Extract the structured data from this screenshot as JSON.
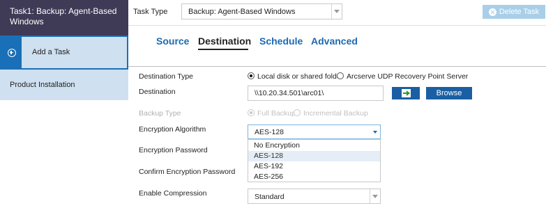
{
  "sidebar": {
    "task_title": "Task1: Backup: Agent-Based Windows",
    "add_task_label": "Add a Task",
    "product_installation_label": "Product Installation"
  },
  "topbar": {
    "task_type_label": "Task Type",
    "task_type_value": "Backup: Agent-Based Windows",
    "delete_task_label": "Delete Task"
  },
  "tabs": [
    {
      "label": "Source",
      "active": false
    },
    {
      "label": "Destination",
      "active": true
    },
    {
      "label": "Schedule",
      "active": false
    },
    {
      "label": "Advanced",
      "active": false
    }
  ],
  "form": {
    "destination_type": {
      "label": "Destination Type",
      "options": [
        {
          "label": "Local disk or shared folder",
          "checked": true
        },
        {
          "label": "Arcserve UDP Recovery Point Server",
          "checked": false
        }
      ]
    },
    "destination": {
      "label": "Destination",
      "value": "\\\\10.20.34.501\\arc01\\",
      "browse_label": "Browse"
    },
    "backup_type": {
      "label": "Backup Type",
      "disabled": true,
      "options": [
        {
          "label": "Full Backup",
          "checked": true
        },
        {
          "label": "Incremental Backup",
          "checked": false
        }
      ]
    },
    "encryption_algorithm": {
      "label": "Encryption Algorithm",
      "value": "AES-128",
      "options": [
        "No Encryption",
        "AES-128",
        "AES-192",
        "AES-256"
      ],
      "highlighted": "AES-128"
    },
    "encryption_password": {
      "label": "Encryption Password"
    },
    "confirm_encryption_password": {
      "label": "Confirm Encryption Password"
    },
    "compression": {
      "label": "Enable Compression",
      "value": "Standard"
    }
  },
  "colors": {
    "sidebar_dark": "#3f3a56",
    "sidebar_light": "#cfe0f0",
    "accent_blue": "#1a70b8",
    "button_blue": "#1a5fa3",
    "tab_blue": "#1c69b2",
    "delete_disabled": "#a9cfe8"
  }
}
